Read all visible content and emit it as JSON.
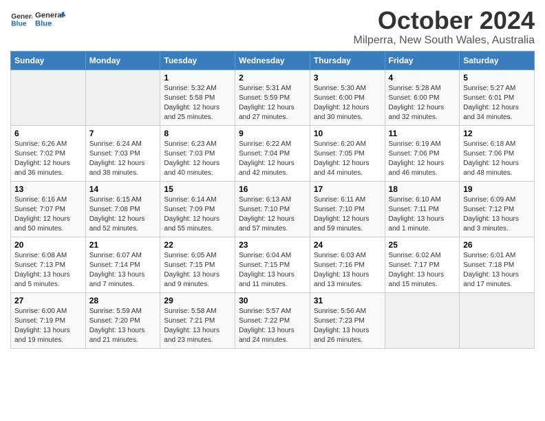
{
  "logo": {
    "text_general": "General",
    "text_blue": "Blue"
  },
  "header": {
    "month": "October 2024",
    "location": "Milperra, New South Wales, Australia"
  },
  "weekdays": [
    "Sunday",
    "Monday",
    "Tuesday",
    "Wednesday",
    "Thursday",
    "Friday",
    "Saturday"
  ],
  "weeks": [
    [
      {
        "day": "",
        "empty": true
      },
      {
        "day": "",
        "empty": true
      },
      {
        "day": "1",
        "sunrise": "5:32 AM",
        "sunset": "5:58 PM",
        "daylight": "12 hours and 25 minutes."
      },
      {
        "day": "2",
        "sunrise": "5:31 AM",
        "sunset": "5:59 PM",
        "daylight": "12 hours and 27 minutes."
      },
      {
        "day": "3",
        "sunrise": "5:30 AM",
        "sunset": "6:00 PM",
        "daylight": "12 hours and 30 minutes."
      },
      {
        "day": "4",
        "sunrise": "5:28 AM",
        "sunset": "6:00 PM",
        "daylight": "12 hours and 32 minutes."
      },
      {
        "day": "5",
        "sunrise": "5:27 AM",
        "sunset": "6:01 PM",
        "daylight": "12 hours and 34 minutes."
      }
    ],
    [
      {
        "day": "6",
        "sunrise": "6:26 AM",
        "sunset": "7:02 PM",
        "daylight": "12 hours and 36 minutes."
      },
      {
        "day": "7",
        "sunrise": "6:24 AM",
        "sunset": "7:03 PM",
        "daylight": "12 hours and 38 minutes."
      },
      {
        "day": "8",
        "sunrise": "6:23 AM",
        "sunset": "7:03 PM",
        "daylight": "12 hours and 40 minutes."
      },
      {
        "day": "9",
        "sunrise": "6:22 AM",
        "sunset": "7:04 PM",
        "daylight": "12 hours and 42 minutes."
      },
      {
        "day": "10",
        "sunrise": "6:20 AM",
        "sunset": "7:05 PM",
        "daylight": "12 hours and 44 minutes."
      },
      {
        "day": "11",
        "sunrise": "6:19 AM",
        "sunset": "7:06 PM",
        "daylight": "12 hours and 46 minutes."
      },
      {
        "day": "12",
        "sunrise": "6:18 AM",
        "sunset": "7:06 PM",
        "daylight": "12 hours and 48 minutes."
      }
    ],
    [
      {
        "day": "13",
        "sunrise": "6:16 AM",
        "sunset": "7:07 PM",
        "daylight": "12 hours and 50 minutes."
      },
      {
        "day": "14",
        "sunrise": "6:15 AM",
        "sunset": "7:08 PM",
        "daylight": "12 hours and 52 minutes."
      },
      {
        "day": "15",
        "sunrise": "6:14 AM",
        "sunset": "7:09 PM",
        "daylight": "12 hours and 55 minutes."
      },
      {
        "day": "16",
        "sunrise": "6:13 AM",
        "sunset": "7:10 PM",
        "daylight": "12 hours and 57 minutes."
      },
      {
        "day": "17",
        "sunrise": "6:11 AM",
        "sunset": "7:10 PM",
        "daylight": "12 hours and 59 minutes."
      },
      {
        "day": "18",
        "sunrise": "6:10 AM",
        "sunset": "7:11 PM",
        "daylight": "13 hours and 1 minute."
      },
      {
        "day": "19",
        "sunrise": "6:09 AM",
        "sunset": "7:12 PM",
        "daylight": "13 hours and 3 minutes."
      }
    ],
    [
      {
        "day": "20",
        "sunrise": "6:08 AM",
        "sunset": "7:13 PM",
        "daylight": "13 hours and 5 minutes."
      },
      {
        "day": "21",
        "sunrise": "6:07 AM",
        "sunset": "7:14 PM",
        "daylight": "13 hours and 7 minutes."
      },
      {
        "day": "22",
        "sunrise": "6:05 AM",
        "sunset": "7:15 PM",
        "daylight": "13 hours and 9 minutes."
      },
      {
        "day": "23",
        "sunrise": "6:04 AM",
        "sunset": "7:15 PM",
        "daylight": "13 hours and 11 minutes."
      },
      {
        "day": "24",
        "sunrise": "6:03 AM",
        "sunset": "7:16 PM",
        "daylight": "13 hours and 13 minutes."
      },
      {
        "day": "25",
        "sunrise": "6:02 AM",
        "sunset": "7:17 PM",
        "daylight": "13 hours and 15 minutes."
      },
      {
        "day": "26",
        "sunrise": "6:01 AM",
        "sunset": "7:18 PM",
        "daylight": "13 hours and 17 minutes."
      }
    ],
    [
      {
        "day": "27",
        "sunrise": "6:00 AM",
        "sunset": "7:19 PM",
        "daylight": "13 hours and 19 minutes."
      },
      {
        "day": "28",
        "sunrise": "5:59 AM",
        "sunset": "7:20 PM",
        "daylight": "13 hours and 21 minutes."
      },
      {
        "day": "29",
        "sunrise": "5:58 AM",
        "sunset": "7:21 PM",
        "daylight": "13 hours and 23 minutes."
      },
      {
        "day": "30",
        "sunrise": "5:57 AM",
        "sunset": "7:22 PM",
        "daylight": "13 hours and 24 minutes."
      },
      {
        "day": "31",
        "sunrise": "5:56 AM",
        "sunset": "7:23 PM",
        "daylight": "13 hours and 26 minutes."
      },
      {
        "day": "",
        "empty": true
      },
      {
        "day": "",
        "empty": true
      }
    ]
  ],
  "sunrise_label": "Sunrise:",
  "sunset_label": "Sunset:",
  "daylight_label": "Daylight:"
}
